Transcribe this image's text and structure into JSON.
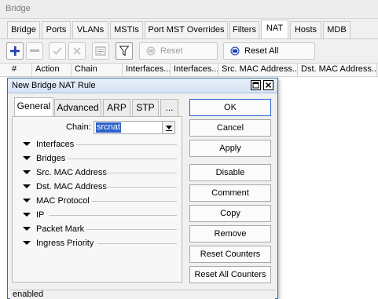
{
  "bridge_window": {
    "title": "Bridge",
    "tabs": [
      {
        "label": "Bridge",
        "active": false
      },
      {
        "label": "Ports",
        "active": false
      },
      {
        "label": "VLANs",
        "active": false
      },
      {
        "label": "MSTIs",
        "active": false
      },
      {
        "label": "Port MST Overrides",
        "active": false
      },
      {
        "label": "Filters",
        "active": false
      },
      {
        "label": "NAT",
        "active": true
      },
      {
        "label": "Hosts",
        "active": false
      },
      {
        "label": "MDB",
        "active": false
      }
    ],
    "toolbar": {
      "add_icon": "plus-icon",
      "remove_icon": "minus-icon",
      "enable_icon": "check-icon",
      "disable_icon": "x-icon",
      "comment_icon": "note-icon",
      "filter_icon": "funnel-icon",
      "reset_counters_label": "Reset Counters",
      "reset_all_counters_label": "Reset All Counters",
      "accent_color": "#1d3fb0"
    },
    "grid_columns": [
      "#",
      "Action",
      "Chain",
      "Interfaces...",
      "Interfaces...",
      "Src. MAC Address...",
      "Dst. MAC Address..."
    ]
  },
  "nat_dialog": {
    "title": "New Bridge NAT Rule",
    "tabs": [
      {
        "label": "General",
        "active": true
      },
      {
        "label": "Advanced",
        "active": false
      },
      {
        "label": "ARP",
        "active": false
      },
      {
        "label": "STP",
        "active": false
      },
      {
        "label": "...",
        "active": false
      }
    ],
    "chain": {
      "label": "Chain:",
      "value": "srcnat"
    },
    "sections": [
      "Interfaces",
      "Bridges",
      "Src. MAC Address",
      "Dst. MAC Address",
      "MAC Protocol",
      "IP",
      "Packet Mark",
      "Ingress Priority"
    ],
    "buttons": {
      "ok": "OK",
      "cancel": "Cancel",
      "apply": "Apply",
      "disable": "Disable",
      "comment": "Comment",
      "copy": "Copy",
      "remove": "Remove",
      "reset_counters": "Reset Counters",
      "reset_all_counters": "Reset All Counters"
    },
    "status": "enabled"
  }
}
